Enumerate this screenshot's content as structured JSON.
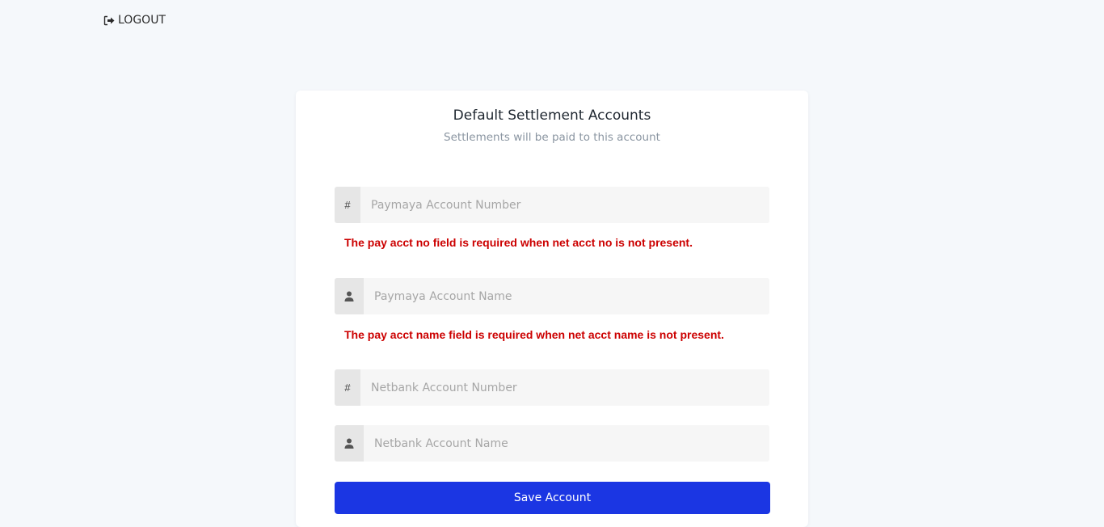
{
  "header": {
    "logout_label": "LOGOUT"
  },
  "card": {
    "title": "Default Settlement Accounts",
    "subtitle": "Settlements will be paid to this account"
  },
  "fields": {
    "paymaya_number": {
      "addon": "#",
      "placeholder": "Paymaya Account Number",
      "value": ""
    },
    "paymaya_name": {
      "addon_icon": "user-icon",
      "placeholder": "Paymaya Account Name",
      "value": ""
    },
    "netbank_number": {
      "addon": "#",
      "placeholder": "Netbank Account Number",
      "value": ""
    },
    "netbank_name": {
      "addon_icon": "user-icon",
      "placeholder": "Netbank Account Name",
      "value": ""
    }
  },
  "errors": {
    "paymaya_number": "The pay acct no field is required when net acct no is not present.",
    "paymaya_name": "The pay acct name field is required when net acct name is not present."
  },
  "actions": {
    "save_label": "Save Account"
  },
  "colors": {
    "background": "#f5f8fb",
    "error": "#cc0000",
    "primary_button": "#1b36e3"
  }
}
